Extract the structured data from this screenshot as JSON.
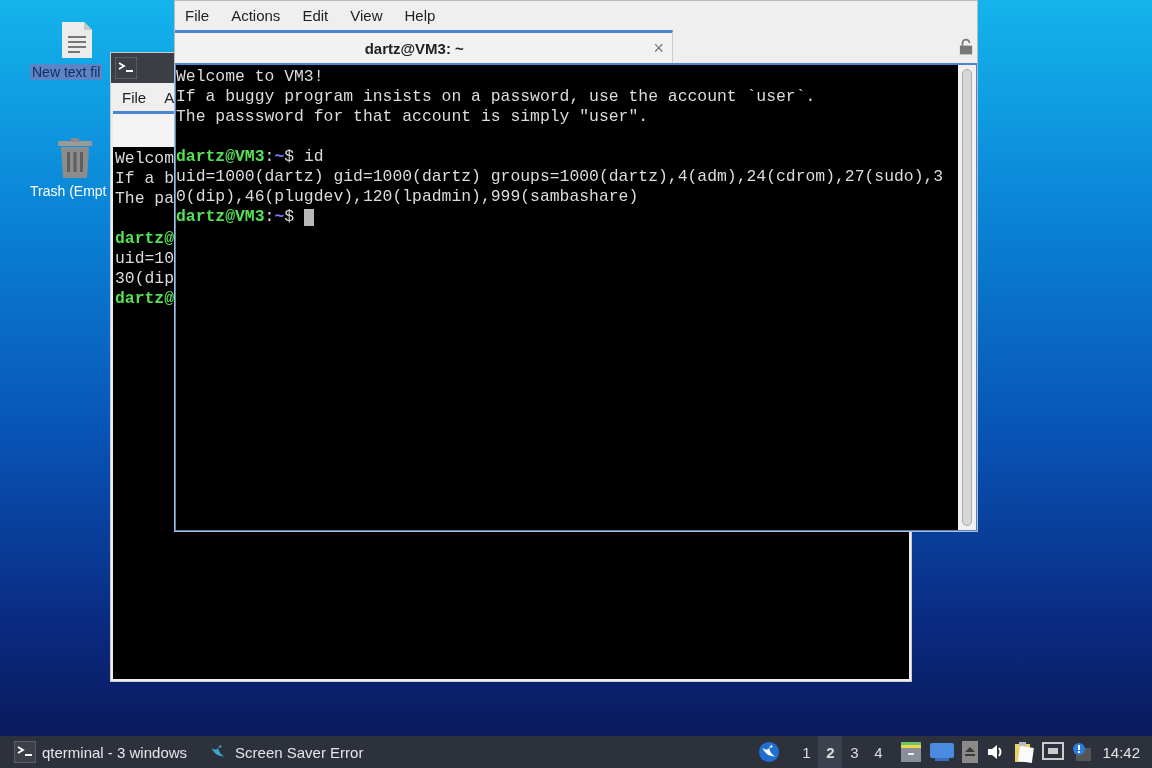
{
  "desktop_icons": [
    {
      "kind": "document",
      "label": "New text fil",
      "selected": true
    },
    {
      "kind": "trash",
      "label": "Trash (Empt",
      "selected": false
    }
  ],
  "back_window": {
    "menu": [
      "File",
      "A"
    ],
    "lines": [
      {
        "kind": "output",
        "text": "Welcom"
      },
      {
        "kind": "output",
        "text": "If a b"
      },
      {
        "kind": "output",
        "text": "The pa"
      },
      {
        "kind": "blank"
      },
      {
        "kind": "prompt",
        "segments": [
          {
            "kind": "user",
            "text": "dartz@"
          }
        ]
      },
      {
        "kind": "output",
        "text": "uid=10"
      },
      {
        "kind": "output",
        "text": "30(dip"
      },
      {
        "kind": "prompt",
        "segments": [
          {
            "kind": "user",
            "text": "dartz@"
          }
        ]
      }
    ]
  },
  "front_window": {
    "menu": [
      "File",
      "Actions",
      "Edit",
      "View",
      "Help"
    ],
    "tab": {
      "title": "dartz@VM3: ~",
      "close": "×"
    },
    "lines": [
      {
        "kind": "output",
        "text": "Welcome to VM3!",
        "cursor": false
      },
      {
        "kind": "output",
        "text": "If a buggy program insists on a password, use the account `user`.",
        "cursor": false
      },
      {
        "kind": "output",
        "text": "The passsword for that account is simply \"user\".",
        "cursor": false
      },
      {
        "kind": "blank"
      },
      {
        "kind": "prompt",
        "segments": [
          {
            "kind": "user",
            "text": "dartz@VM3"
          },
          {
            "kind": "plain",
            "text": ":"
          },
          {
            "kind": "path",
            "text": "~"
          },
          {
            "kind": "plain",
            "text": "$ id"
          }
        ],
        "cursor": false
      },
      {
        "kind": "output",
        "text": "uid=1000(dartz) gid=1000(dartz) groups=1000(dartz),4(adm),24(cdrom),27(sudo),3",
        "cursor": false
      },
      {
        "kind": "output",
        "text": "0(dip),46(plugdev),120(lpadmin),999(sambashare)",
        "cursor": false
      },
      {
        "kind": "prompt",
        "segments": [
          {
            "kind": "user",
            "text": "dartz@VM3"
          },
          {
            "kind": "plain",
            "text": ":"
          },
          {
            "kind": "path",
            "text": "~"
          },
          {
            "kind": "plain",
            "text": "$ "
          }
        ],
        "cursor": true
      }
    ]
  },
  "taskbar": {
    "tasks": [
      {
        "kind": "terminal",
        "label": "qterminal - 3 windows"
      },
      {
        "kind": "bird",
        "label": "Screen Saver Error"
      }
    ],
    "workspaces": [
      {
        "label": "1",
        "selected": false
      },
      {
        "label": "2",
        "selected": true
      },
      {
        "label": "3",
        "selected": false
      },
      {
        "label": "4",
        "selected": false
      }
    ],
    "clock": "14:42"
  }
}
